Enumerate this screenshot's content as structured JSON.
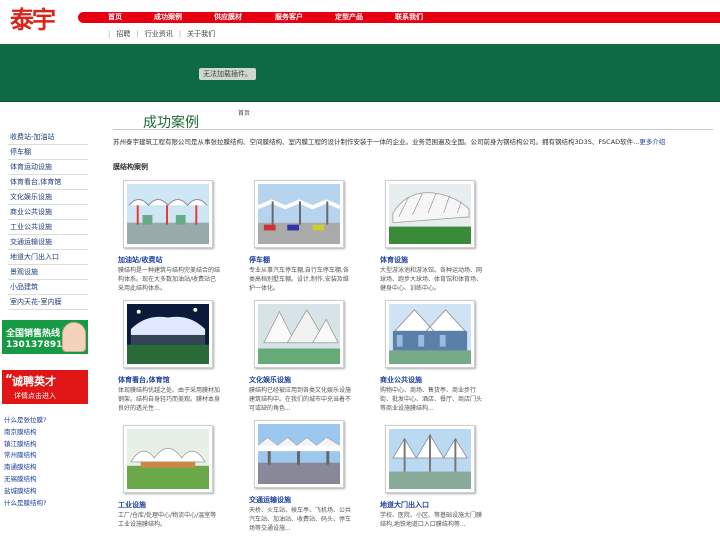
{
  "logo": "泰宇",
  "nav": [
    "首页",
    "成功案例",
    "供应膜材",
    "服务客户",
    "定型产品",
    "联系我们"
  ],
  "subnav": [
    "招聘",
    "行业资讯",
    "关于我们"
  ],
  "banner": {
    "plugin_message": "无法加载插件。"
  },
  "page": {
    "title": "成功案例",
    "breadcrumb": "首页"
  },
  "sidebar": [
    "收费站-加油站",
    "停车棚",
    "体育运动设施",
    "体育看台,体育馆",
    "文化娱乐设施",
    "商业公共设施",
    "工业公共设施",
    "交通运输设施",
    "地道大门出入口",
    "景观设施",
    "小品建筑",
    "室内天花-室内膜"
  ],
  "promo1": {
    "line1": "全国销售热线",
    "line2": "13013789168"
  },
  "promo2": {
    "line1": "诚聘英才",
    "line2": "详情点击进入"
  },
  "faq": [
    "什么是张拉膜?",
    "南京膜结构",
    "镇江膜结构",
    "常州膜结构",
    "南通膜结构",
    "无锡膜结构",
    "盐城膜结构",
    "什么是膜结构?"
  ],
  "intro": {
    "text": "苏州泰宇建筑工程有限公司是从事张拉膜结构、空间膜结构、室内膜工程的设计制作安装于一体的企业。业务范围遍及全国。公司前身为钢结构公司。拥有钢结构3D3S、FSCAD软件...",
    "more": "更多介绍"
  },
  "section_title": "膜结构案例",
  "products": [
    {
      "title": "加油站/收费站",
      "desc": "膜结构是一种建筑与结构完美结合的结构体系。现在大多数加油站/收费站已采用此结构体系。"
    },
    {
      "title": "停车棚",
      "desc": "专业从事汽车停车棚,自行车停车棚,各类高档别墅车棚。设计,制作,安装及维护一体化。"
    },
    {
      "title": "体育设施",
      "desc": "大型游泳池和游泳馆。各种运动场、网球场、跑步大球场、体育馆和体育场、健身中心、训练中心。"
    },
    {
      "title": "体育看台,体育馆",
      "desc": "体现膜结构优越之处。由于采用膜材加钢架。结构自身轻巧而美观。膜材本身良好的透光性..."
    },
    {
      "title": "文化娱乐设施",
      "desc": "膜结构已经被应用到各类文化娱乐设施建筑结构中。在我们的城市中充当着不可或缺的角色..."
    },
    {
      "title": "商业公共设施",
      "desc": "购物中心、商场、售货亭、商业步行街、批发中心、酒店、餐厅、商店门头等商业设施膜结构..."
    },
    {
      "title": "工业设施",
      "desc": "工厂/仓库/处理中心/物流中心/温室等工业设施膜结构。"
    },
    {
      "title": "交通运输设施",
      "desc": "天桥、火车站、候车亭、飞机场、公共汽车站、加油站、收费站、码头、停车场等交通设施..."
    },
    {
      "title": "地道大门出入口",
      "desc": "学校、医院、小区、等基础设施大门膜结构,地铁地道口入口膜结构等..."
    }
  ],
  "colors": {
    "brand_red": "#e60012",
    "banner_green": "#0e6a45",
    "link_blue": "#1e40a0"
  }
}
